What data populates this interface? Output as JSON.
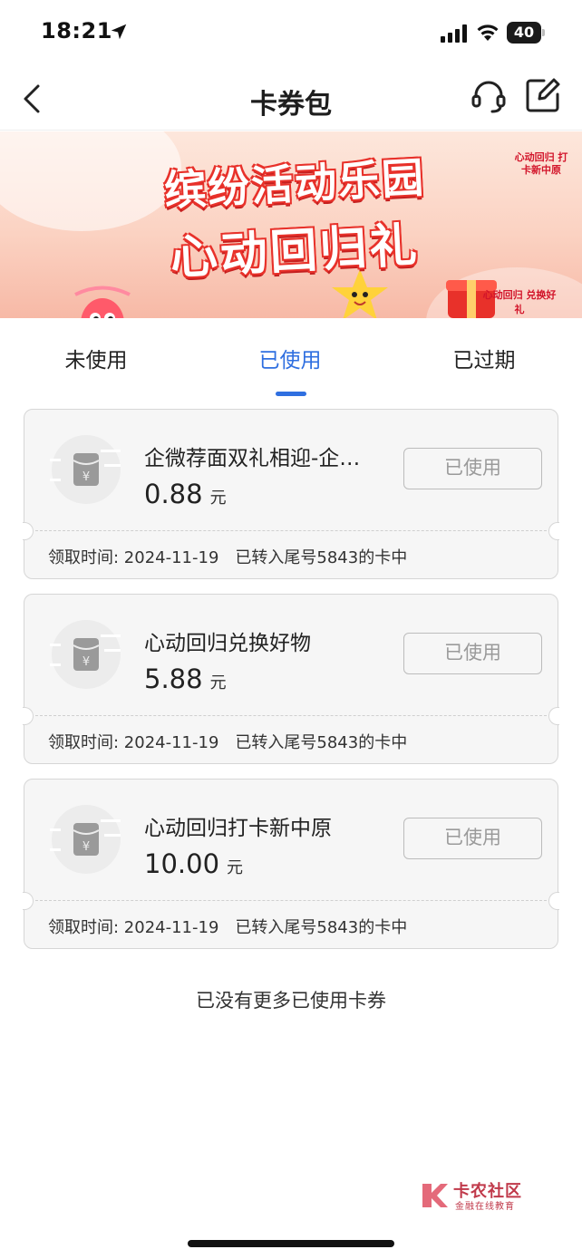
{
  "status_bar": {
    "time": "18:21",
    "battery": "40"
  },
  "nav": {
    "title": "卡券包"
  },
  "banner": {
    "title_line1": "缤纷活动乐园",
    "title_line2": "心动回归礼",
    "side_tag": "心动回归 打卡新中原",
    "bottom_tag": "心动回归 兑换好礼"
  },
  "tabs": [
    {
      "label": "未使用",
      "active": false
    },
    {
      "label": "已使用",
      "active": true
    },
    {
      "label": "已过期",
      "active": false
    }
  ],
  "coupons": [
    {
      "name": "企微荐面双礼相迎-企…",
      "amount": "0.88",
      "unit": "元",
      "button": "已使用",
      "received_label": "领取时间: 2024-11-19",
      "status_text": "已转入尾号5843的卡中"
    },
    {
      "name": "心动回归兑换好物",
      "amount": "5.88",
      "unit": "元",
      "button": "已使用",
      "received_label": "领取时间: 2024-11-19",
      "status_text": "已转入尾号5843的卡中"
    },
    {
      "name": "心动回归打卡新中原",
      "amount": "10.00",
      "unit": "元",
      "button": "已使用",
      "received_label": "领取时间: 2024-11-19",
      "status_text": "已转入尾号5843的卡中"
    }
  ],
  "end_text": "已没有更多已使用卡券",
  "watermark": {
    "title": "卡农社区",
    "subtitle": "金融在线教育"
  },
  "colors": {
    "accent": "#2f6fe0",
    "banner_red": "#e8312a",
    "card_bg": "#f6f6f6"
  }
}
